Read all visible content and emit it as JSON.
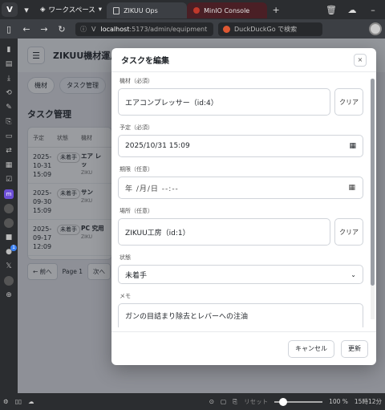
{
  "browser": {
    "workspace_label": "ワークスペース",
    "tabs": [
      {
        "title": "ZIKUU Ops"
      },
      {
        "title": "MinIO Console"
      }
    ],
    "new_tab": "+",
    "url_host": "localhost",
    "url_path": ":5173/admin/equipment",
    "search_placeholder": "DuckDuckGo で検索"
  },
  "app": {
    "title": "ZIKUU機材運用",
    "nav_pills": [
      "機材",
      "タスク管理"
    ],
    "section_title": "タスク管理",
    "table": {
      "headers": [
        "予定",
        "状態",
        "機材"
      ],
      "rows": [
        {
          "date": "2025-10-31 15:09",
          "status": "未着手",
          "equip": "エア レッ",
          "sub": "ZIKU"
        },
        {
          "date": "2025-09-30 15:09",
          "status": "未着手",
          "equip": "サン",
          "sub": "ZIKU"
        },
        {
          "date": "2025-09-17 12:09",
          "status": "未着手",
          "equip": "PC 究用",
          "sub": "ZIKU"
        }
      ]
    },
    "pager": {
      "prev": "← 前へ",
      "page": "Page 1",
      "next": "次へ"
    }
  },
  "modal": {
    "title": "タスクを編集",
    "close": "×",
    "equipment_label": "機材（必須）",
    "equipment_value": "エアコンプレッサー（id:4）",
    "clear_label": "クリア",
    "scheduled_label": "予定（必須）",
    "scheduled_value": "2025/10/31 15:09",
    "due_label": "期限（任意）",
    "due_placeholder": "年 /月/日 --:--",
    "location_label": "場所（任意）",
    "location_value": "ZIKUU工房（id:1）",
    "status_label": "状態",
    "status_value": "未着手",
    "memo_label": "メモ",
    "memo_value": "ガンの目詰まり除去とレバーへの注油",
    "cancel_label": "キャンセル",
    "update_label": "更新"
  },
  "statusbar": {
    "reset": "リセット",
    "zoom": "100 %",
    "time": "15時12分"
  },
  "colors": {
    "chrome_bg": "#2b2d30",
    "page_bg": "#e9eaee",
    "modal_bg": "#ffffff",
    "inactive_tab": "#4a1f25"
  }
}
